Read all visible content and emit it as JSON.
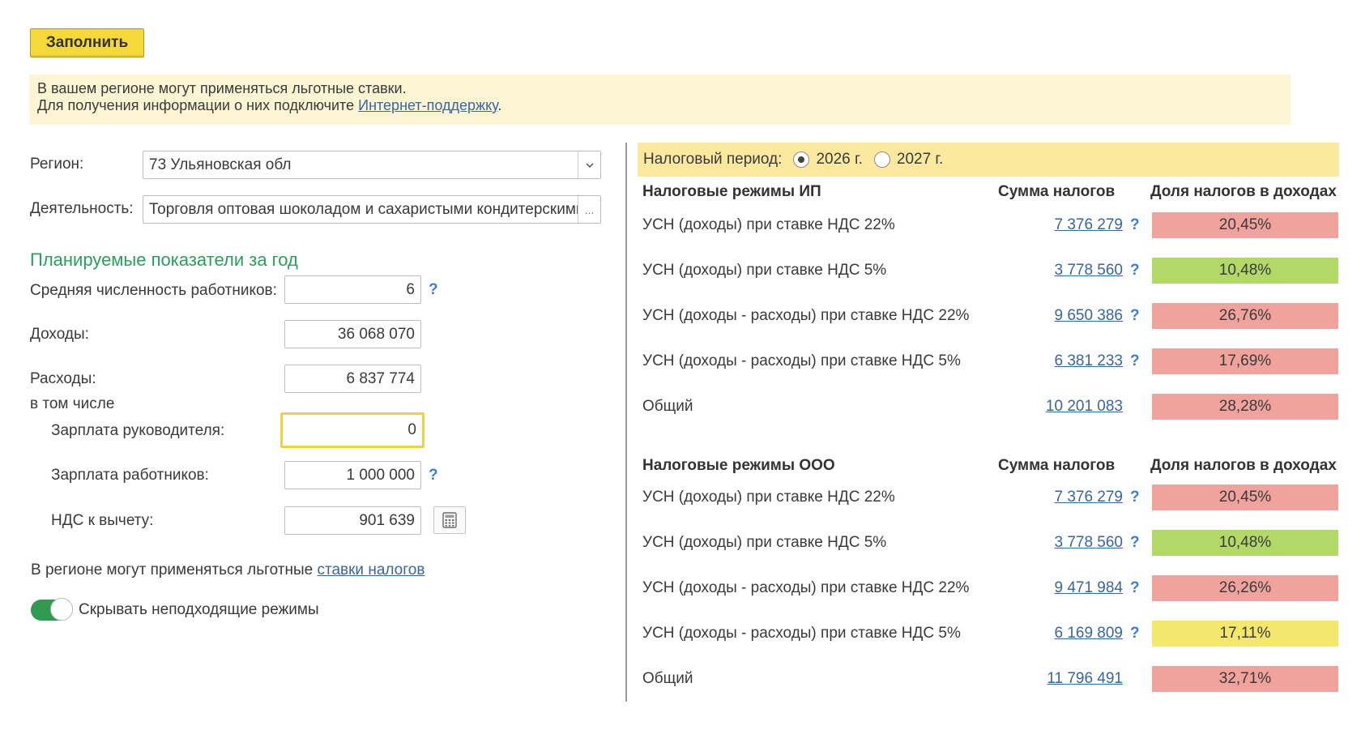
{
  "fill_button": "Заполнить",
  "info": {
    "line1": "В вашем регионе могут применяться льготные ставки.",
    "line2_prefix": "Для получения информации о них подключите ",
    "line2_link": "Интернет-поддержку",
    "line2_suffix": "."
  },
  "form": {
    "region_label": "Регион:",
    "region_value": "73 Ульяновская обл",
    "activity_label": "Деятельность:",
    "activity_value": "Торговля оптовая шоколадом и сахаристыми кондитерскими",
    "activity_button": "...",
    "section_title": "Планируемые показатели за год",
    "employees_label": "Средняя численность работников:",
    "employees_value": "6",
    "income_label": "Доходы:",
    "income_value": "36 068 070",
    "expenses_label": "Расходы:",
    "including_label": "в том числе",
    "director_salary_label": "Зарплата руководителя:",
    "director_salary_value": "0",
    "staff_salary_label": "Зарплата работников:",
    "staff_salary_value": "1 000 000",
    "vat_deduction_label": "НДС к вычету:",
    "vat_deduction_value": "901 639",
    "expenses_value": "6 837 774",
    "help_mark": "?",
    "region_note_prefix": "В регионе могут применяться льготные ",
    "region_note_link": "ставки налогов",
    "toggle_label": "Скрывать неподходящие режимы",
    "toggle_on": true
  },
  "period": {
    "label": "Налоговый период:",
    "options": [
      "2026 г.",
      "2027 г."
    ],
    "selected": "2026 г."
  },
  "colors": {
    "red": "#f0a29d",
    "green": "#b3d86a",
    "yellow": "#f5e66e"
  },
  "ip": {
    "header": "Налоговые режимы ИП",
    "sum_header": "Сумма налогов",
    "share_header": "Доля налогов в доходах",
    "rows": [
      {
        "name": "УСН (доходы) при ставке НДС 22%",
        "amount": "7 376 279",
        "help": "?",
        "share": "20,45%",
        "color": "red"
      },
      {
        "name": "УСН (доходы) при ставке НДС 5%",
        "amount": "3 778 560",
        "help": "?",
        "share": "10,48%",
        "color": "green"
      },
      {
        "name": "УСН (доходы - расходы) при ставке НДС 22%",
        "amount": "9 650 386",
        "help": "?",
        "share": "26,76%",
        "color": "red"
      },
      {
        "name": "УСН (доходы - расходы) при ставке НДС 5%",
        "amount": "6 381 233",
        "help": "?",
        "share": "17,69%",
        "color": "red"
      },
      {
        "name": "Общий",
        "amount": "10 201 083",
        "help": "",
        "share": "28,28%",
        "color": "red"
      }
    ]
  },
  "ooo": {
    "header": "Налоговые режимы ООО",
    "sum_header": "Сумма налогов",
    "share_header": "Доля налогов в доходах",
    "rows": [
      {
        "name": "УСН (доходы) при ставке НДС 22%",
        "amount": "7 376 279",
        "help": "?",
        "share": "20,45%",
        "color": "red"
      },
      {
        "name": "УСН (доходы) при ставке НДС 5%",
        "amount": "3 778 560",
        "help": "?",
        "share": "10,48%",
        "color": "green"
      },
      {
        "name": "УСН (доходы - расходы) при ставке НДС 22%",
        "amount": "9 471 984",
        "help": "?",
        "share": "26,26%",
        "color": "red"
      },
      {
        "name": "УСН (доходы - расходы) при ставке НДС 5%",
        "amount": "6 169 809",
        "help": "?",
        "share": "17,11%",
        "color": "yellow"
      },
      {
        "name": "Общий",
        "amount": "11 796 491",
        "help": "",
        "share": "32,71%",
        "color": "red"
      }
    ]
  }
}
